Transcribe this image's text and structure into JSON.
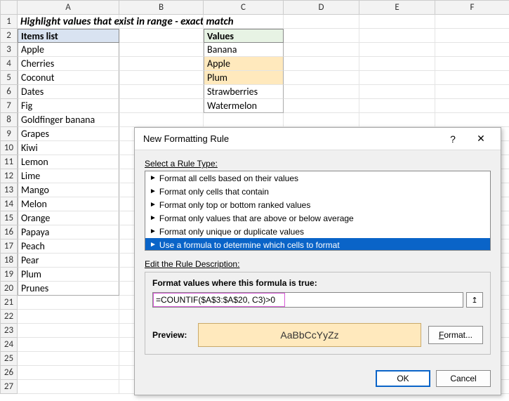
{
  "columns": [
    "A",
    "B",
    "C",
    "D",
    "E",
    "F"
  ],
  "row_count": 27,
  "title": "Highlight values that exist in range - exact match",
  "headers": {
    "a": "Items list",
    "c": "Values"
  },
  "items": [
    "Apple",
    "Cherries",
    "Coconut",
    "Dates",
    "Fig",
    "Goldfinger banana",
    "Grapes",
    "Kiwi",
    "Lemon",
    "Lime",
    "Mango",
    "Melon",
    "Orange",
    "Papaya",
    "Peach",
    "Pear",
    "Plum",
    "Prunes"
  ],
  "values": [
    {
      "text": "Banana",
      "hl": false
    },
    {
      "text": "Apple",
      "hl": true
    },
    {
      "text": "Plum",
      "hl": true
    },
    {
      "text": "Strawberries",
      "hl": false
    },
    {
      "text": "Watermelon",
      "hl": false
    }
  ],
  "dialog": {
    "title": "New Formatting Rule",
    "help_icon": "?",
    "close_icon": "✕",
    "select_label": "Select a Rule Type:",
    "rules": [
      "Format all cells based on their values",
      "Format only cells that contain",
      "Format only top or bottom ranked values",
      "Format only values that are above or below average",
      "Format only unique or duplicate values",
      "Use a formula to determine which cells to format"
    ],
    "selected_rule_index": 5,
    "edit_label": "Edit the Rule Description:",
    "formula_label": "Format values where this formula is true:",
    "formula_value": "=COUNTIF($A$3:$A$20, C3)>0",
    "ref_icon": "↥",
    "preview_label": "Preview:",
    "preview_text": "AaBbCcYyZz",
    "format_btn": "Format...",
    "ok": "OK",
    "cancel": "Cancel"
  }
}
